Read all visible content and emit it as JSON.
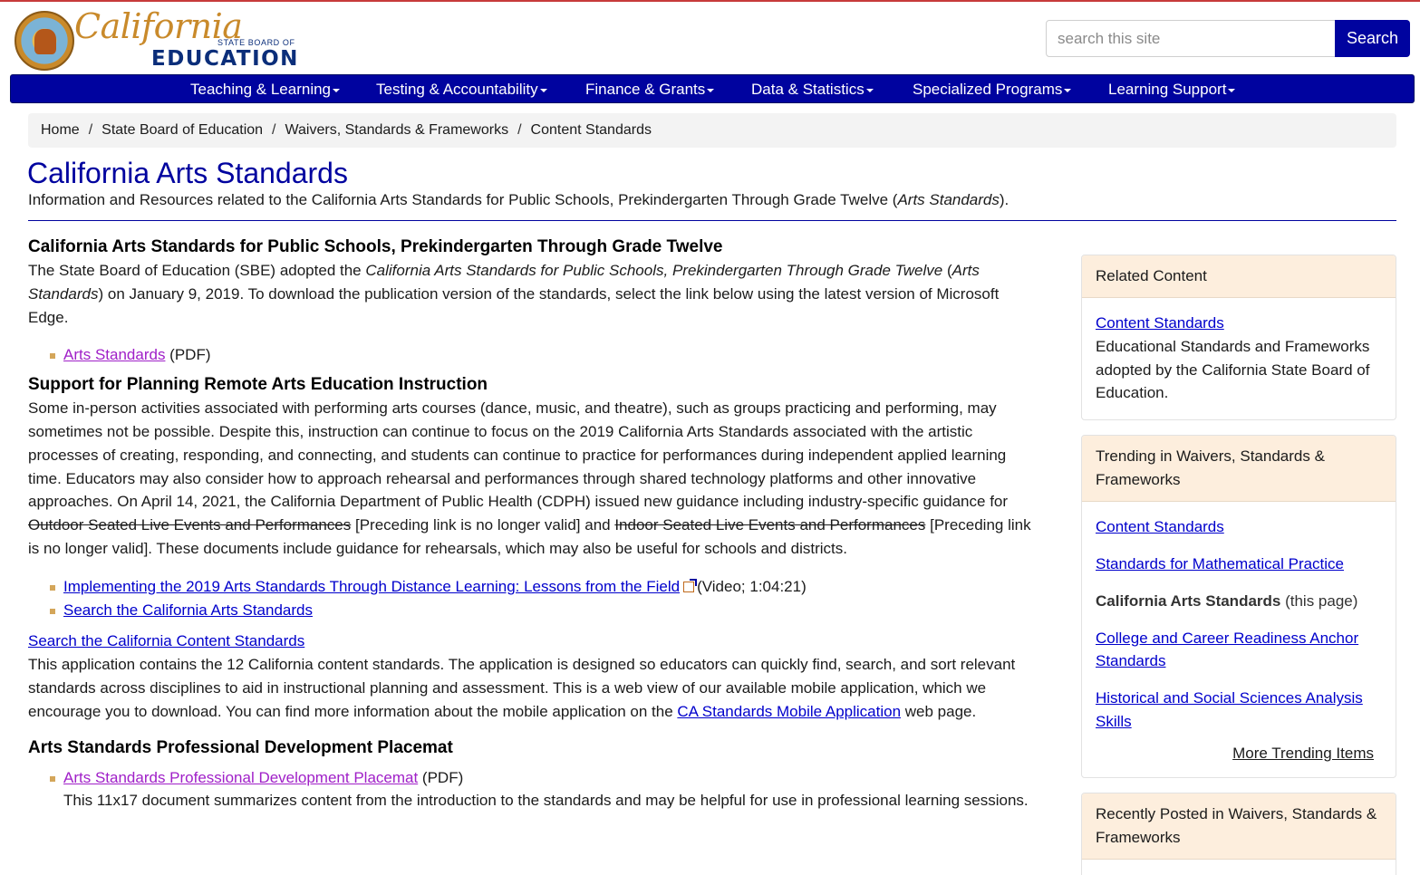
{
  "header": {
    "logo_california": "California",
    "logo_state_board": "STATE BOARD OF",
    "logo_education": "EDUCATION",
    "search_placeholder": "search this site",
    "search_button": "Search"
  },
  "nav": {
    "items": [
      {
        "label": "Teaching & Learning"
      },
      {
        "label": "Testing & Accountability"
      },
      {
        "label": "Finance & Grants"
      },
      {
        "label": "Data & Statistics"
      },
      {
        "label": "Specialized Programs"
      },
      {
        "label": "Learning Support"
      }
    ]
  },
  "breadcrumb": {
    "items": [
      "Home",
      "State Board of Education",
      "Waivers, Standards & Frameworks",
      "Content Standards"
    ],
    "separator": "/"
  },
  "page": {
    "title": "California Arts Standards",
    "lead_prefix": "Information and Resources related to the California Arts Standards for Public Schools, Prekindergarten Through Grade Twelve (",
    "lead_italic": "Arts Standards",
    "lead_suffix": ")."
  },
  "main": {
    "s1": {
      "heading": "California Arts Standards for Public Schools, Prekindergarten Through Grade Twelve",
      "p_prefix": "The State Board of Education (SBE) adopted the ",
      "p_italic1": "California Arts Standards for Public Schools, Prekindergarten Through Grade Twelve",
      "p_mid": " (",
      "p_italic2": "Arts Standards",
      "p_suffix": ") on January 9, 2019. To download the publication version of the standards, select the link below using the latest version of Microsoft Edge.",
      "link": "Arts Standards",
      "link_note": " (PDF)"
    },
    "s2": {
      "heading": "Support for Planning Remote Arts Education Instruction",
      "p_part1": "Some in-person activities associated with performing arts courses (dance, music, and theatre), such as groups practicing and performing, may sometimes not be possible. Despite this, instruction can continue to focus on the 2019 California Arts Standards associated with the artistic processes of creating, responding, and connecting, and students can continue to practice for performances during independent applied learning time. Educators may also consider how to approach rehearsal and performances through shared technology platforms and other innovative approaches. On April 14, 2021, the California Department of Public Health (CDPH) issued new guidance including industry-specific guidance for ",
      "strike1": "Outdoor Seated Live Events and Performances",
      "p_part2": " [Preceding link is no longer valid] and ",
      "strike2": "Indoor Seated Live Events and Performances",
      "p_part3": " [Preceding link is no longer valid]. These documents include guidance for rehearsals, which may also be useful for schools and districts.",
      "link1": "Implementing the 2019 Arts Standards Through Distance Learning: Lessons from the Field",
      "link1_note": "(Video; 1:04:21)",
      "link2": "Search the California Arts Standards"
    },
    "s3": {
      "link": "Search the California Content Standards",
      "p_prefix": "This application contains the 12 California content standards. The application is designed so educators can quickly find, search, and sort relevant standards across disciplines to aid in instructional planning and assessment. This is a web view of our available mobile application, which we encourage you to download. You can find more information about the mobile application on the ",
      "p_link": "CA Standards Mobile Application",
      "p_suffix": " web page."
    },
    "s4": {
      "heading": "Arts Standards Professional Development Placemat",
      "link": "Arts Standards Professional Development Placemat",
      "link_note": " (PDF)",
      "desc": "This 11x17 document summarizes content from the introduction to the standards and may be helpful for use in professional learning sessions."
    }
  },
  "sidebar": {
    "related": {
      "title": "Related Content",
      "link": "Content Standards",
      "desc": "Educational Standards and Frameworks adopted by the California State Board of Education."
    },
    "trending": {
      "title": "Trending in Waivers, Standards & Frameworks",
      "items": [
        {
          "label": "Content Standards"
        },
        {
          "label": "Standards for Mathematical Practice"
        },
        {
          "label": "California Arts Standards",
          "note": " (this page)"
        },
        {
          "label": "College and Career Readiness Anchor Standards"
        },
        {
          "label": "Historical and Social Sciences Analysis Skills"
        }
      ],
      "more": "More Trending Items"
    },
    "recent": {
      "title": "Recently Posted in Waivers, Standards & Frameworks"
    }
  },
  "colors": {
    "brand_blue": "#00039f",
    "link": "#0000cc",
    "visited_link": "#a020c8",
    "card_header": "#fdeedd",
    "bullet": "#d4a65a"
  }
}
